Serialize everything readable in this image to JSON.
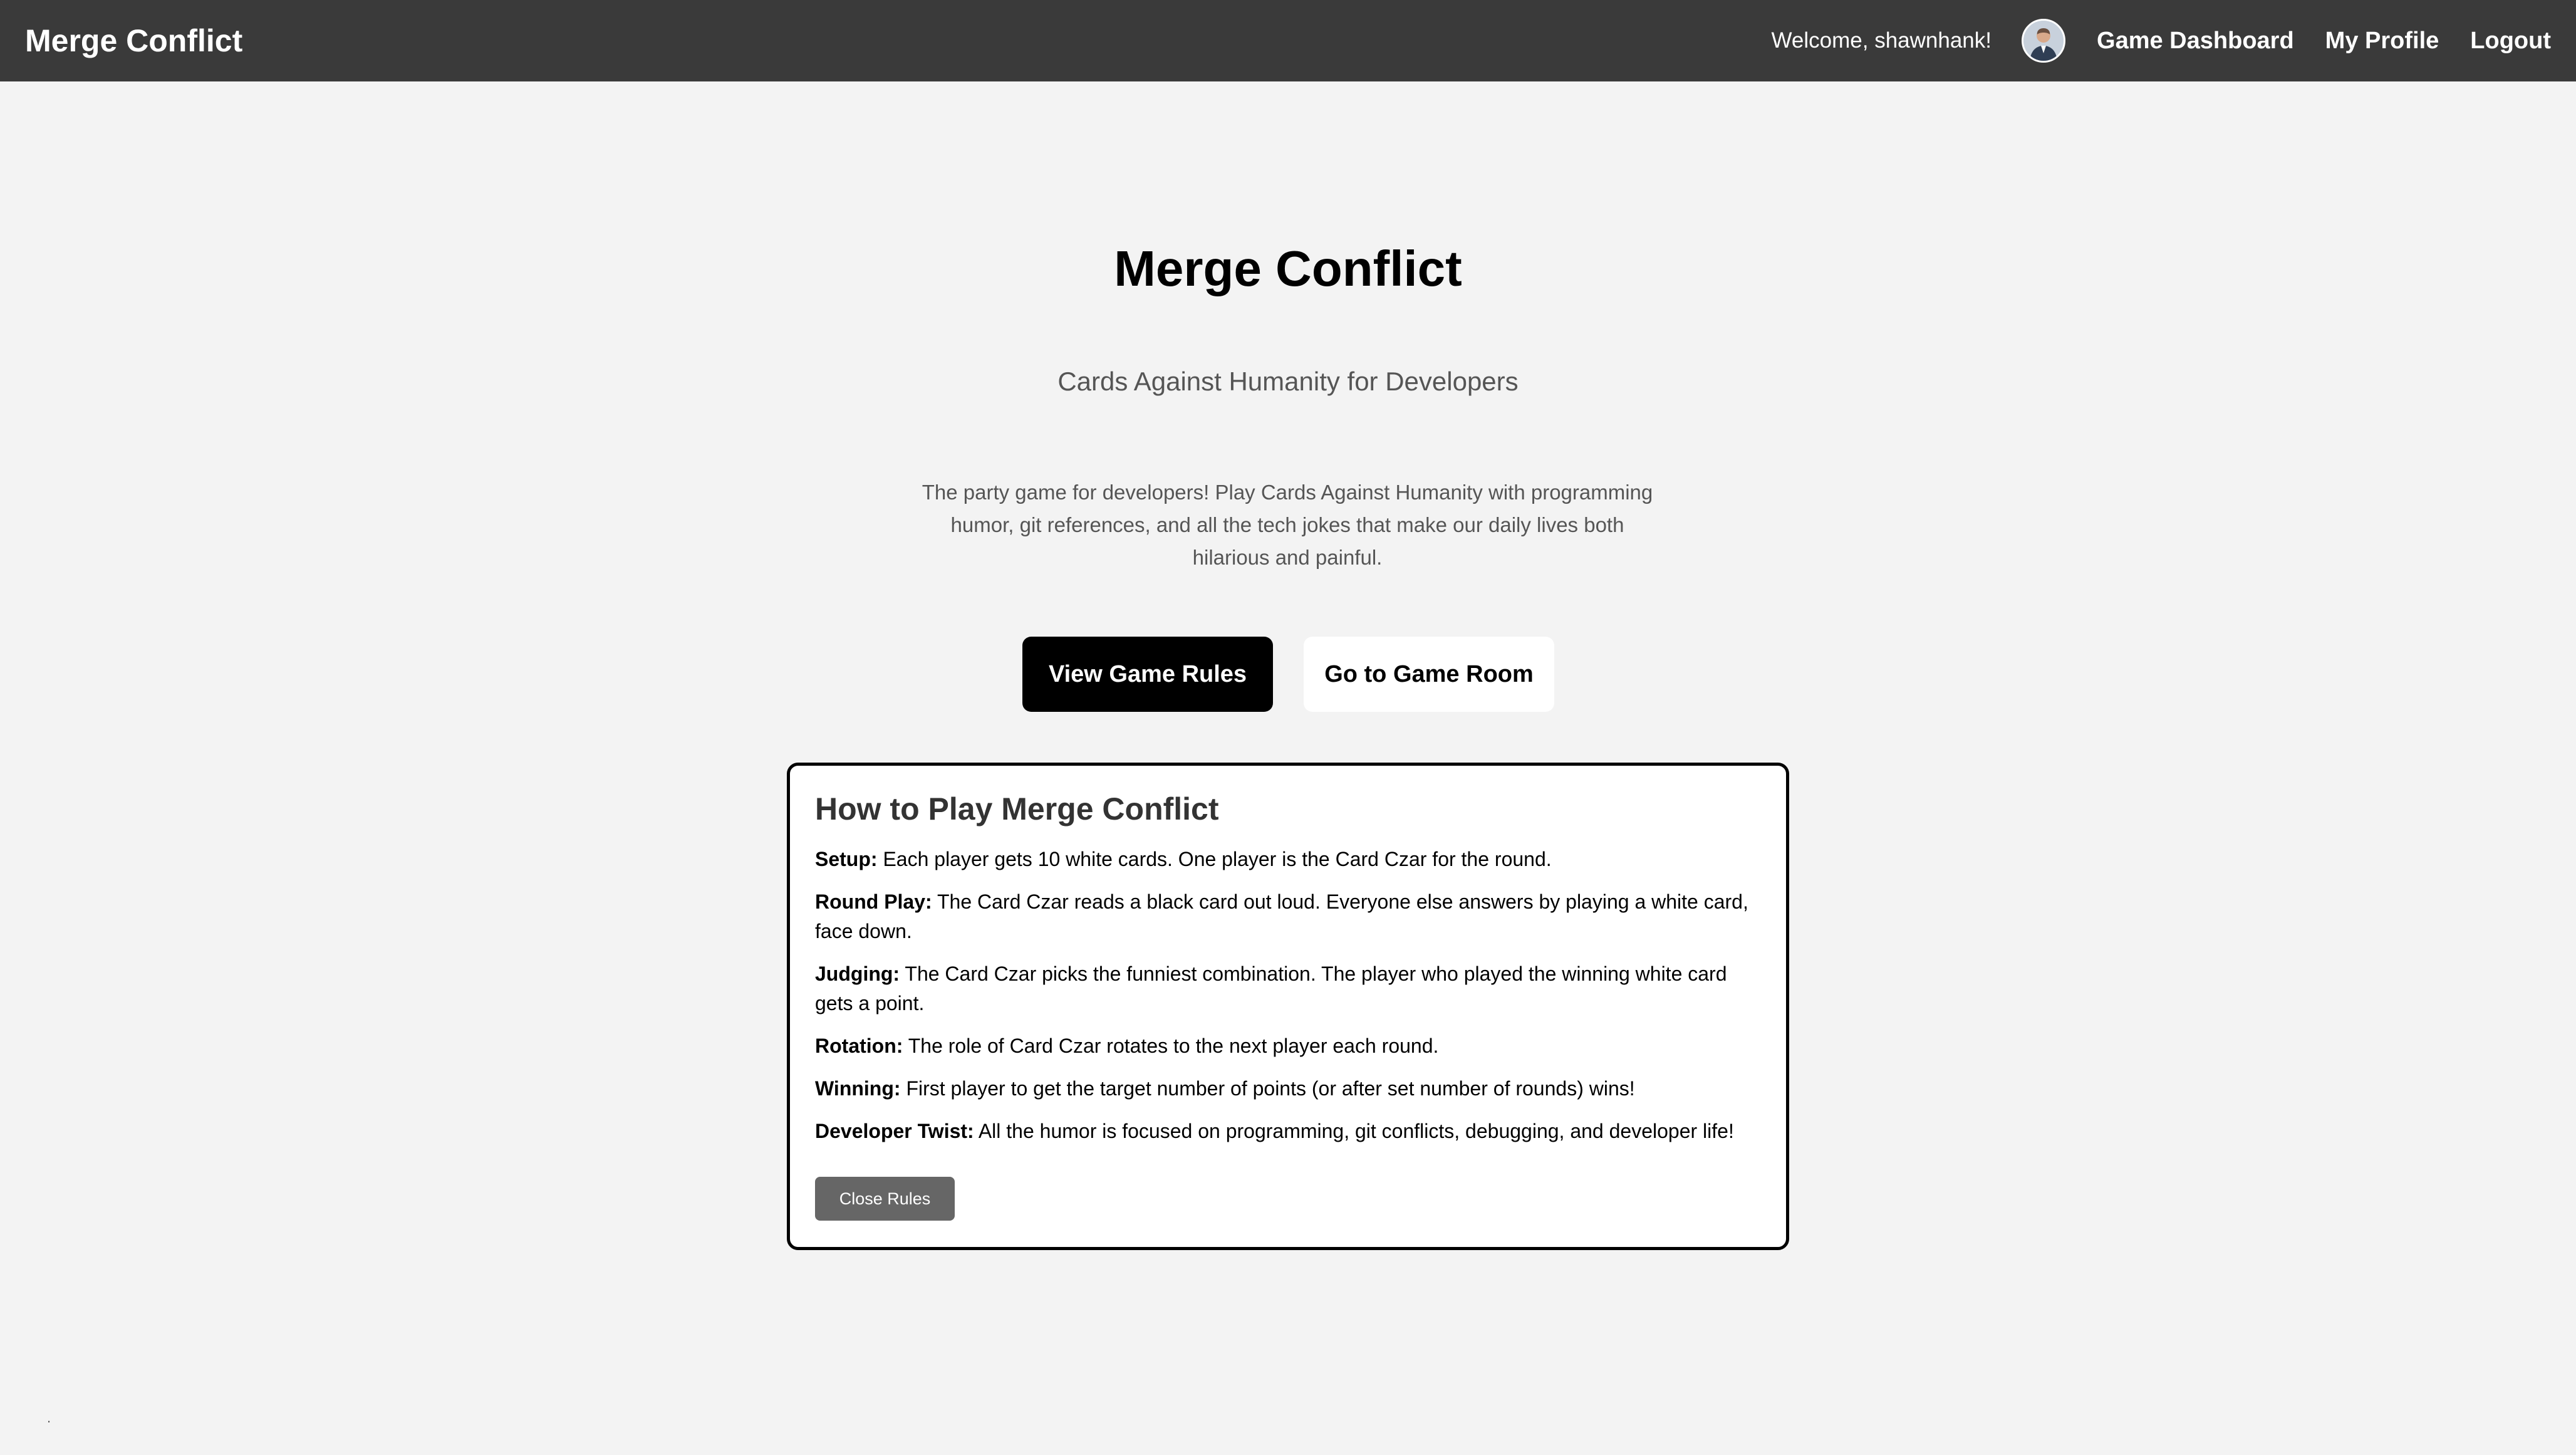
{
  "navbar": {
    "brand": "Merge Conflict",
    "welcome": "Welcome, shawnhank!",
    "links": {
      "dashboard": "Game Dashboard",
      "profile": "My Profile",
      "logout": "Logout"
    }
  },
  "hero": {
    "title": "Merge Conflict",
    "subtitle": "Cards Against Humanity for Developers",
    "description": "The party game for developers! Play Cards Against Humanity with programming humor, git references, and all the tech jokes that make our daily lives both hilarious and painful.",
    "view_rules_label": "View Game Rules",
    "game_room_label": "Go to Game Room"
  },
  "rules": {
    "title": "How to Play Merge Conflict",
    "items": [
      {
        "label": "Setup:",
        "text": " Each player gets 10 white cards. One player is the Card Czar for the round."
      },
      {
        "label": "Round Play:",
        "text": " The Card Czar reads a black card out loud. Everyone else answers by playing a white card, face down."
      },
      {
        "label": "Judging:",
        "text": " The Card Czar picks the funniest combination. The player who played the winning white card gets a point."
      },
      {
        "label": "Rotation:",
        "text": " The role of Card Czar rotates to the next player each round."
      },
      {
        "label": "Winning:",
        "text": " First player to get the target number of points (or after set number of rounds) wins!"
      },
      {
        "label": "Developer Twist:",
        "text": " All the humor is focused on programming, git conflicts, debugging, and developer life!"
      }
    ],
    "close_label": "Close Rules"
  },
  "footer": {
    "mark": "."
  },
  "colors": {
    "navbar_bg": "#3a3a3a",
    "page_bg": "#f3f3f3",
    "primary_button": "#000000",
    "close_button": "#666666"
  }
}
